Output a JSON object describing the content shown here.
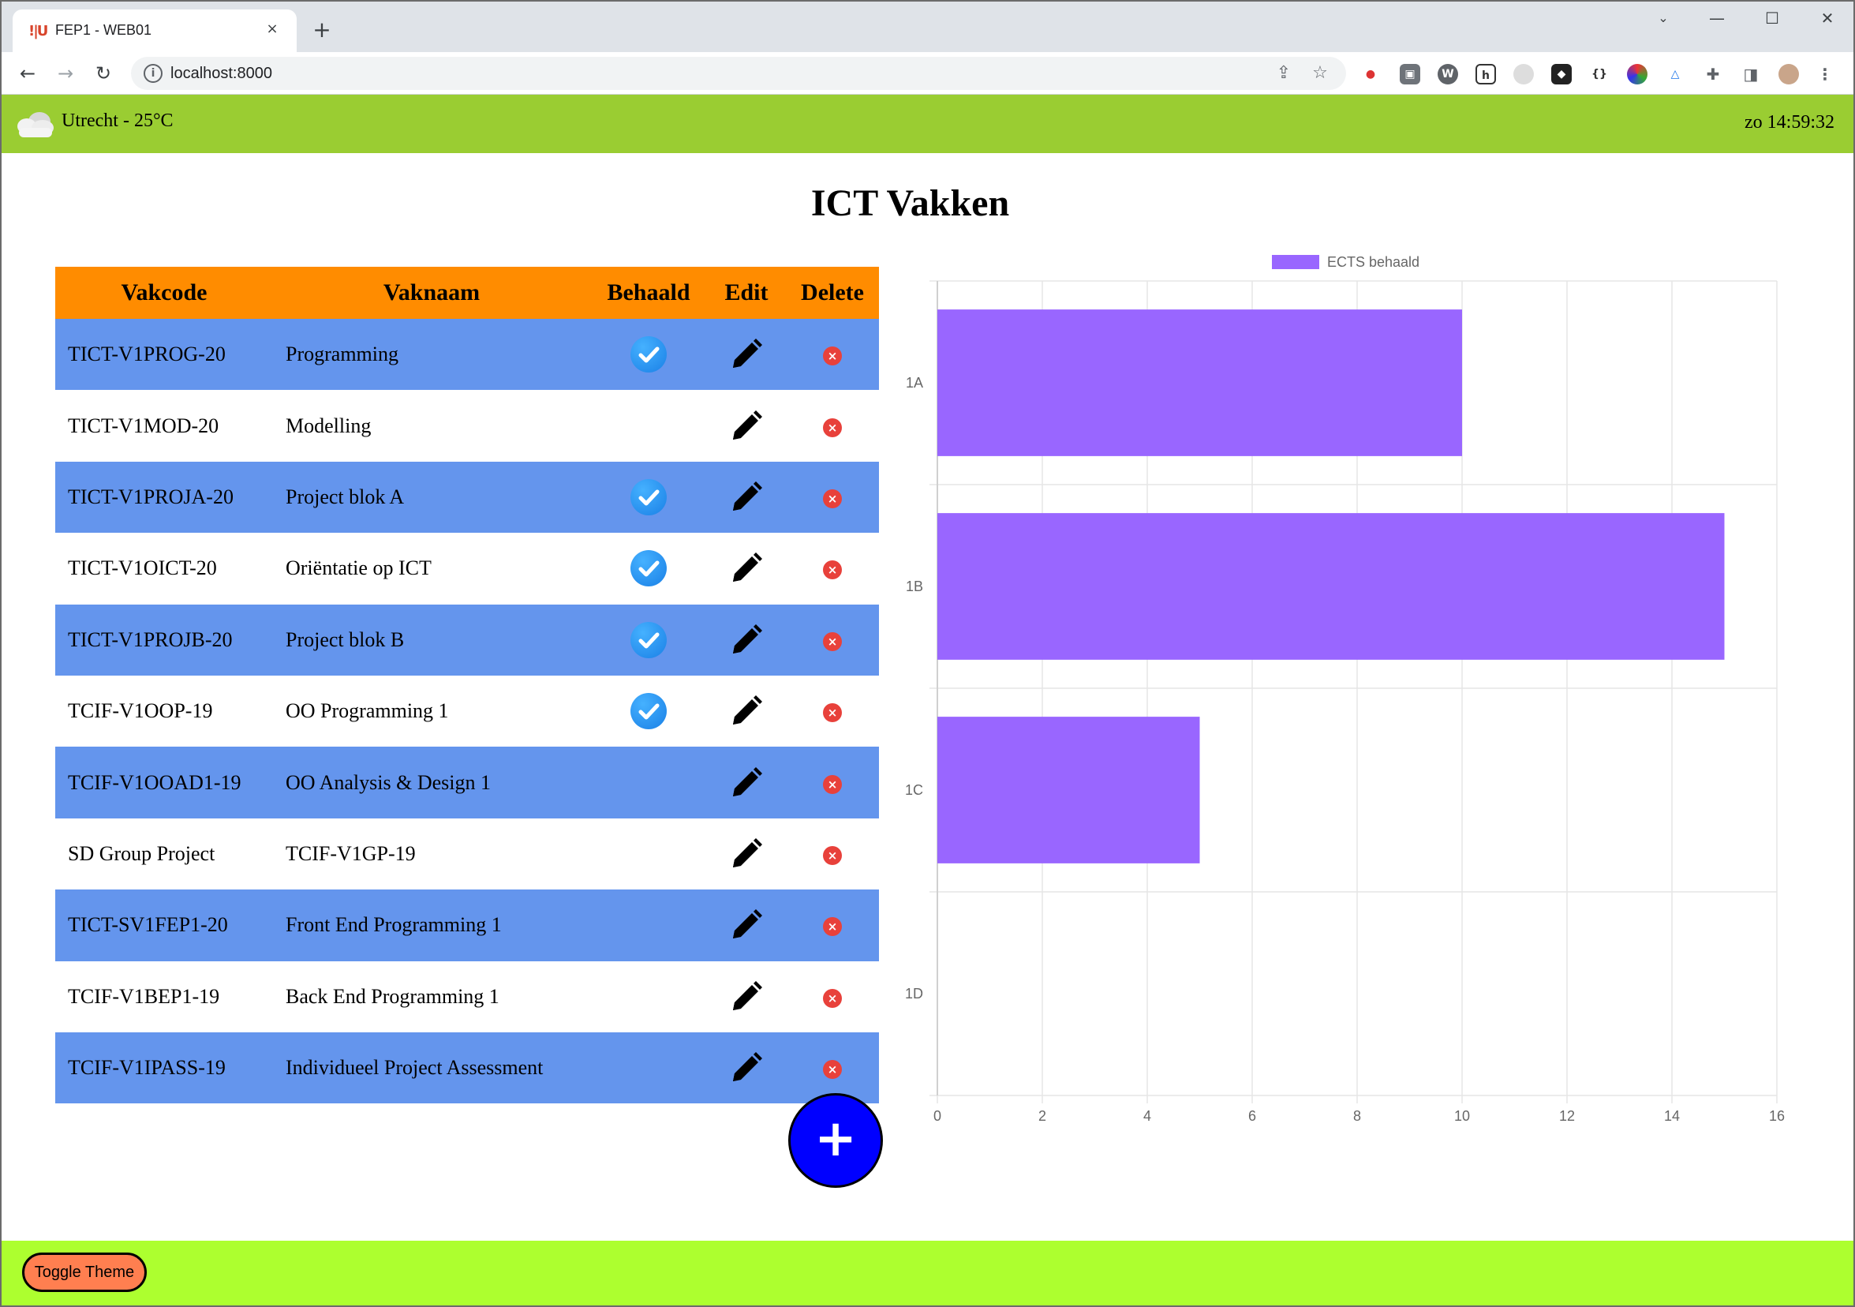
{
  "browser": {
    "tab_title": "FEP1 - WEB01",
    "tab_favicon": "!|U",
    "url": "localhost:8000",
    "close_tab": "×",
    "new_tab": "+"
  },
  "header": {
    "weather": "Utrecht - 25°C",
    "clock": "zo 14:59:32"
  },
  "page": {
    "title": "ICT Vakken"
  },
  "table": {
    "columns": [
      "Vakcode",
      "Vaknaam",
      "Behaald",
      "Edit",
      "Delete"
    ],
    "rows": [
      {
        "code": "TICT-V1PROG-20",
        "name": "Programming",
        "behaald": true
      },
      {
        "code": "TICT-V1MOD-20",
        "name": "Modelling",
        "behaald": false
      },
      {
        "code": "TICT-V1PROJA-20",
        "name": "Project blok A",
        "behaald": true
      },
      {
        "code": "TICT-V1OICT-20",
        "name": "Oriëntatie op ICT",
        "behaald": true
      },
      {
        "code": "TICT-V1PROJB-20",
        "name": "Project blok B",
        "behaald": true
      },
      {
        "code": "TCIF-V1OOP-19",
        "name": "OO Programming 1",
        "behaald": true
      },
      {
        "code": "TCIF-V1OOAD1-19",
        "name": "OO Analysis & Design 1",
        "behaald": false
      },
      {
        "code": "SD Group Project",
        "name": "TCIF-V1GP-19",
        "behaald": false
      },
      {
        "code": "TICT-SV1FEP1-20",
        "name": "Front End Programming 1",
        "behaald": false
      },
      {
        "code": "TCIF-V1BEP1-19",
        "name": "Back End Programming 1",
        "behaald": false
      },
      {
        "code": "TCIF-V1IPASS-19",
        "name": "Individueel Project Assessment",
        "behaald": false
      }
    ],
    "row_colors": {
      "odd": "#6495ed",
      "even": "#ffffff"
    },
    "header_color": "#ff8c00"
  },
  "add_button": {
    "label": "+",
    "color": "#0000ff"
  },
  "footer": {
    "toggle_label": "Toggle Theme",
    "color": "#adff2f"
  },
  "chart_data": {
    "type": "bar",
    "orientation": "horizontal",
    "categories": [
      "1A",
      "1B",
      "1C",
      "1D"
    ],
    "series": [
      {
        "name": "ECTS behaald",
        "values": [
          10,
          15,
          5,
          0
        ],
        "color": "#9966ff"
      }
    ],
    "xlim": [
      0,
      16
    ],
    "xticks": [
      0,
      2,
      4,
      6,
      8,
      10,
      12,
      14,
      16
    ],
    "grid": true,
    "legend": "top"
  }
}
